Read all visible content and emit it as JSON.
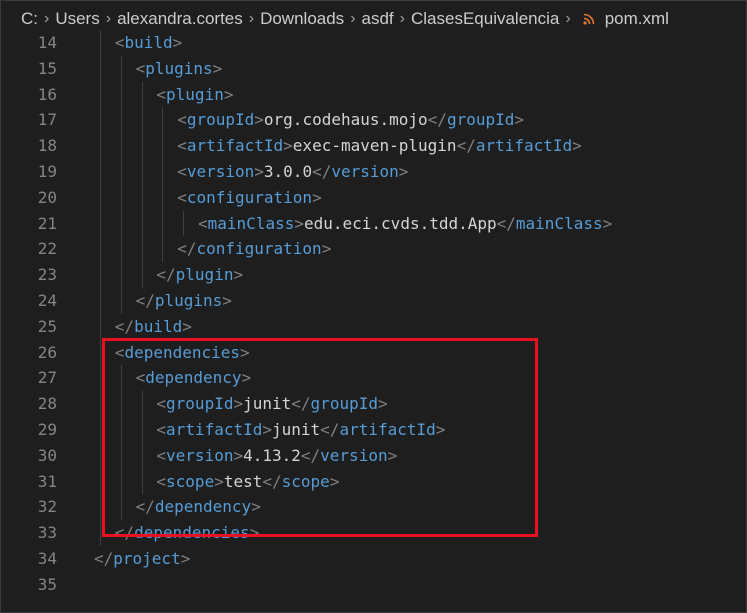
{
  "breadcrumb": {
    "items": [
      "C:",
      "Users",
      "alexandra.cortes",
      "Downloads",
      "asdf",
      "ClasesEquivalencia"
    ],
    "file": "pom.xml",
    "file_icon": "rss-icon"
  },
  "colors": {
    "background": "#1e1e1e",
    "tag": "#569cd6",
    "bracket": "#808080",
    "text": "#d4d4d4",
    "line_number": "#858585",
    "highlight": "#e81123"
  },
  "editor": {
    "lines": [
      {
        "number": "14",
        "indent": 1,
        "tag": "build",
        "closing": false
      },
      {
        "number": "15",
        "indent": 2,
        "tag": "plugins",
        "closing": false
      },
      {
        "number": "16",
        "indent": 3,
        "tag": "plugin",
        "closing": false
      },
      {
        "number": "17",
        "indent": 4,
        "tag": "groupId",
        "text": "org.codehaus.mojo"
      },
      {
        "number": "18",
        "indent": 4,
        "tag": "artifactId",
        "text": "exec-maven-plugin"
      },
      {
        "number": "19",
        "indent": 4,
        "tag": "version",
        "text": "3.0.0"
      },
      {
        "number": "20",
        "indent": 4,
        "tag": "configuration",
        "closing": false
      },
      {
        "number": "21",
        "indent": 5,
        "tag": "mainClass",
        "text": "edu.eci.cvds.tdd.App"
      },
      {
        "number": "22",
        "indent": 4,
        "tag": "configuration",
        "closing": true
      },
      {
        "number": "23",
        "indent": 3,
        "tag": "plugin",
        "closing": true
      },
      {
        "number": "24",
        "indent": 2,
        "tag": "plugins",
        "closing": true
      },
      {
        "number": "25",
        "indent": 1,
        "tag": "build",
        "closing": true
      },
      {
        "number": "26",
        "indent": 1,
        "tag": "dependencies",
        "closing": false
      },
      {
        "number": "27",
        "indent": 2,
        "tag": "dependency",
        "closing": false
      },
      {
        "number": "28",
        "indent": 3,
        "tag": "groupId",
        "text": "junit"
      },
      {
        "number": "29",
        "indent": 3,
        "tag": "artifactId",
        "text": "junit"
      },
      {
        "number": "30",
        "indent": 3,
        "tag": "version",
        "text": "4.13.2"
      },
      {
        "number": "31",
        "indent": 3,
        "tag": "scope",
        "text": "test"
      },
      {
        "number": "32",
        "indent": 2,
        "tag": "dependency",
        "closing": true
      },
      {
        "number": "33",
        "indent": 1,
        "tag": "dependencies",
        "closing": true
      },
      {
        "number": "34",
        "indent": 0,
        "tag": "project",
        "closing": true
      },
      {
        "number": "35",
        "indent": 0,
        "empty": true
      }
    ]
  }
}
